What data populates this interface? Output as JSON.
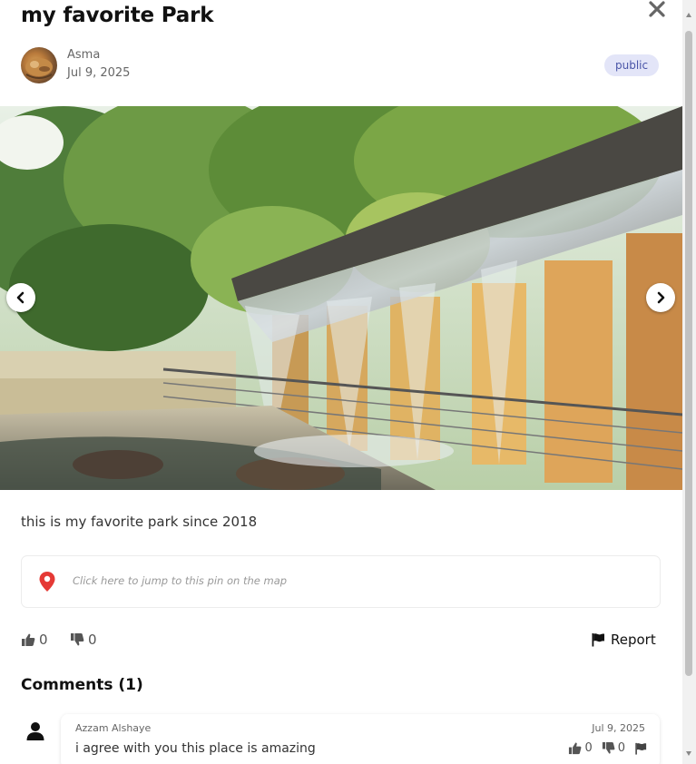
{
  "post": {
    "title": "my favorite Park",
    "author": "Asma",
    "date": "Jul 9, 2025",
    "visibility": "public",
    "description": "this is my favorite park since 2018"
  },
  "location": {
    "hint": "Click here to jump to this pin on the map"
  },
  "reactions": {
    "likes": "0",
    "dislikes": "0",
    "report_label": "Report"
  },
  "comments": {
    "heading": "Comments (1)",
    "items": [
      {
        "author": "Azzam Alshaye",
        "date": "Jul 9, 2025",
        "text": "i agree with you this place is amazing",
        "likes": "0",
        "dislikes": "0"
      }
    ]
  },
  "colors": {
    "pin": "#e53935",
    "badge_bg": "#e3e5f8",
    "badge_text": "#4a55a8"
  },
  "icons": {
    "close": "close-icon",
    "prev": "chevron-left-icon",
    "next": "chevron-right-icon",
    "pin": "map-pin-icon",
    "like": "thumbs-up-icon",
    "dislike": "thumbs-down-icon",
    "report": "flag-icon",
    "user": "user-icon"
  }
}
